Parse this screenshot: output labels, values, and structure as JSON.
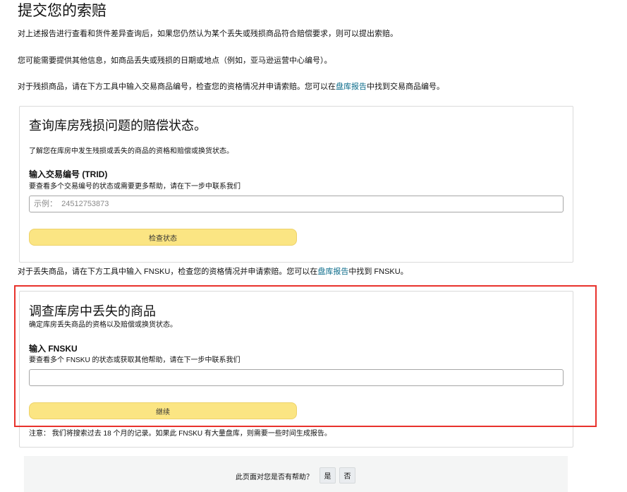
{
  "page": {
    "title": "提交您的索赔",
    "intro_1": "对上述报告进行查看和货件差异查询后，如果您仍然认为某个丢失或残损商品符合赔偿要求，则可以提出索赔。",
    "intro_2": "您可能需要提供其他信息，如商品丢失或残损的日期或地点（例如，亚马逊运营中心编号）。",
    "damaged_pre": "对于残损商品，请在下方工具中输入交易商品编号，检查您的资格情况并申请索赔。您可以在",
    "damaged_link": "盘库报告",
    "damaged_post": "中找到交易商品编号。",
    "lost_pre": "对于丢失商品，请在下方工具中输入 FNSKU，检查您的资格情况并申请索赔。您可以在",
    "lost_link": "盘库报告",
    "lost_post": "中找到 FNSKU。"
  },
  "damage_card": {
    "title": "查询库房残损问题的赔偿状态。",
    "description": "了解您在库房中发生残损或丢失的商品的资格和赔偿或换货状态。",
    "field_label": "输入交易编号 (TRID)",
    "field_help": "要查看多个交易编号的状态或需要更多帮助，请在下一步中联系我们",
    "input_placeholder": "示例：  24512753873",
    "input_value": "",
    "button_label": "检查状态"
  },
  "lost_card": {
    "title": "调查库房中丢失的商品",
    "description": "确定库房丢失商品的资格以及赔偿或换货状态。",
    "field_label": "输入 FNSKU",
    "field_help": "要查看多个 FNSKU 的状态或获取其他帮助，请在下一步中联系我们",
    "input_placeholder": "",
    "input_value": "",
    "button_label": "继续",
    "note": "注意：  我们将搜索过去 18 个月的记录。如果此 FNSKU 有大量盘库，则需要一些时间生成报告。"
  },
  "feedback": {
    "question": "此页面对您是否有帮助？",
    "yes_label": "是",
    "no_label": "否"
  },
  "colors": {
    "button_yellow": "#fbe583",
    "highlight_red": "#e8322c",
    "link_teal": "#0a6b8a"
  }
}
